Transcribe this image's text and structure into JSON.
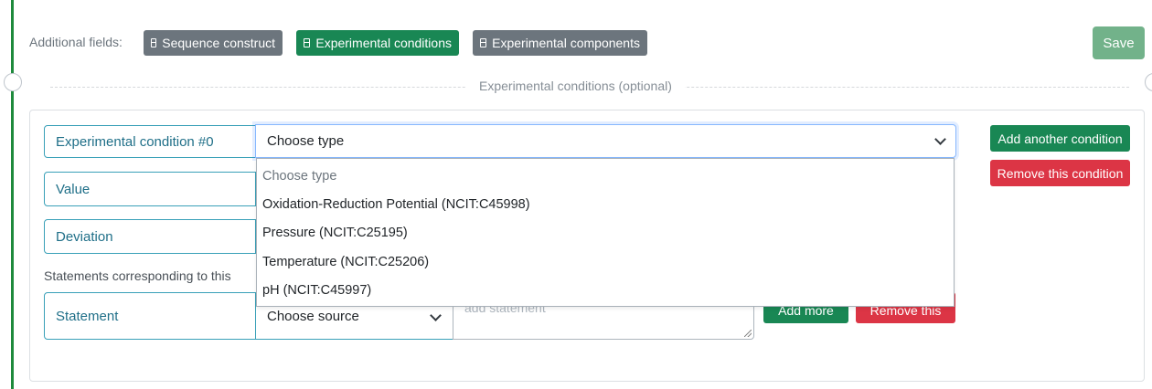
{
  "header": {
    "additional_fields_label": "Additional fields:",
    "tags": [
      {
        "label": "Sequence construct",
        "icon": "form-icon",
        "state": "inactive"
      },
      {
        "label": "Experimental conditions",
        "icon": "form-icon",
        "state": "active"
      },
      {
        "label": "Experimental components",
        "icon": "form-icon",
        "state": "inactive"
      }
    ],
    "save_label": "Save"
  },
  "section": {
    "title": "Experimental conditions (optional)"
  },
  "condition": {
    "label": "Experimental condition #0",
    "type_select": {
      "selected": "Choose type",
      "options": [
        "Choose type",
        "Oxidation-Reduction Potential (NCIT:C45998)",
        "Pressure (NCIT:C25195)",
        "Temperature (NCIT:C25206)",
        "pH (NCIT:C45997)"
      ]
    },
    "value_label": "Value",
    "deviation_label": "Deviation",
    "add_another_label": "Add another condition",
    "remove_label": "Remove this condition"
  },
  "statements": {
    "intro_text": "Statements corresponding to this",
    "row": {
      "label": "Statement",
      "source_selected": "Choose source",
      "textarea_placeholder": "add statement",
      "add_more_label": "Add more",
      "remove_label": "Remove this"
    }
  },
  "colors": {
    "accent_green": "#198754",
    "danger_red": "#dc3545",
    "secondary_gray": "#6c757d",
    "label_border": "#39a0b8",
    "save_disabled": "#72b28a"
  }
}
